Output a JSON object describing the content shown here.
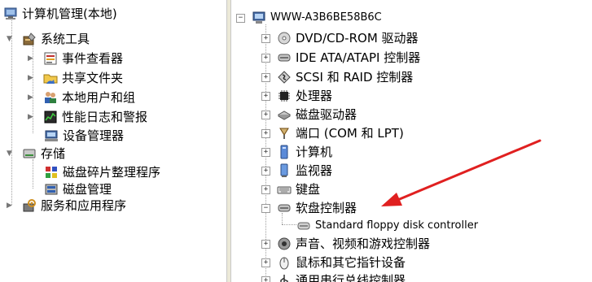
{
  "left_tree": {
    "root": "计算机管理(本地)",
    "system_tools": "系统工具",
    "event_viewer": "事件查看器",
    "shared_folders": "共享文件夹",
    "local_users": "本地用户和组",
    "perf_logs": "性能日志和警报",
    "device_manager": "设备管理器",
    "storage": "存储",
    "defrag": "磁盘碎片整理程序",
    "disk_mgmt": "磁盘管理",
    "services_apps": "服务和应用程序"
  },
  "right_tree": {
    "computer_name": "WWW-A3B6BE58B6C",
    "items": [
      "DVD/CD-ROM 驱动器",
      "IDE ATA/ATAPI 控制器",
      "SCSI 和 RAID 控制器",
      "处理器",
      "磁盘驱动器",
      "端口 (COM 和 LPT)",
      "计算机",
      "监视器",
      "键盘",
      "软盘控制器",
      "Standard floppy disk controller",
      "声音、视频和游戏控制器",
      "鼠标和其它指针设备",
      "通用串行总线控制器"
    ]
  },
  "expander": {
    "plus": "+",
    "minus": "−"
  },
  "annotation_color": "#e02020"
}
